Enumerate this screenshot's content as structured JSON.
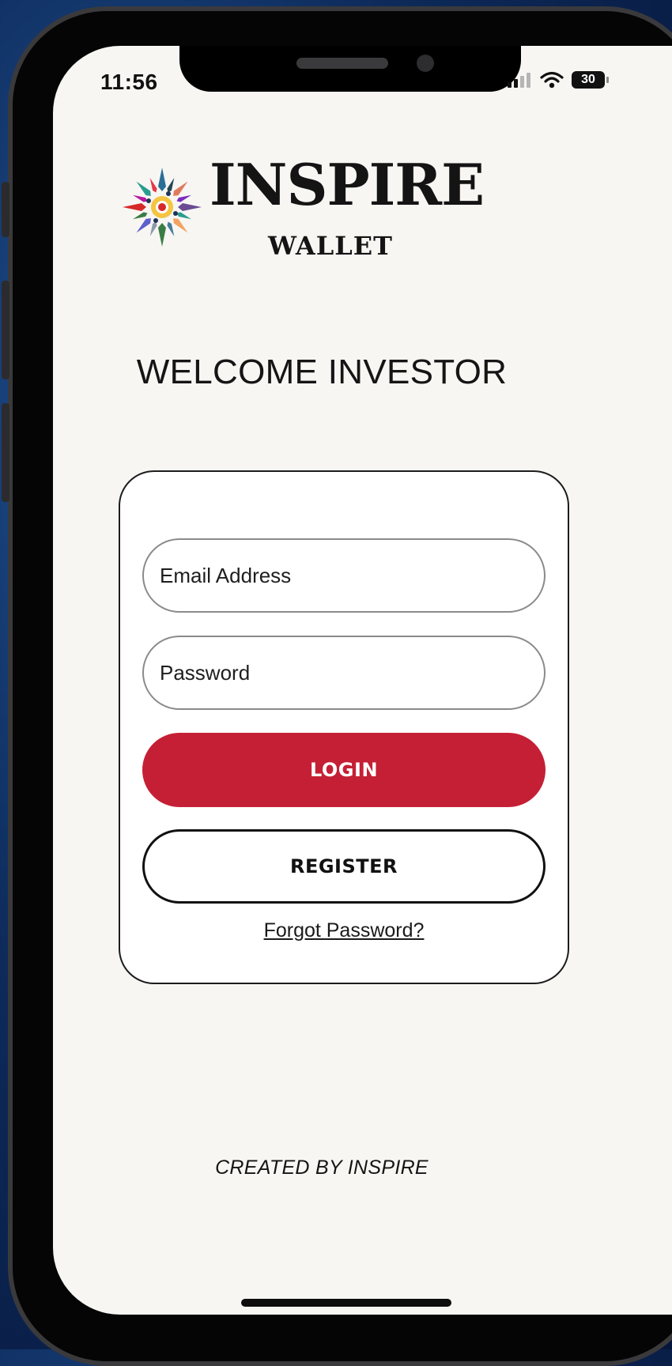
{
  "status_bar": {
    "time": "11:56",
    "battery": "30",
    "icons": [
      "signal-icon",
      "wifi-icon",
      "battery-icon"
    ]
  },
  "brand": {
    "name": "INSPIRE",
    "subtitle": "WALLET",
    "logo_icon": "sunburst-logo-icon"
  },
  "welcome": {
    "heading": "WELCOME INVESTOR"
  },
  "login_form": {
    "email_placeholder": "Email Address",
    "email_value": "",
    "password_placeholder": "Password",
    "password_value": "",
    "login_label": "LOGIN",
    "register_label": "REGISTER",
    "forgot_label": "Forgot Password?"
  },
  "footer": {
    "text": "CREATED BY INSPIRE"
  },
  "colors": {
    "login_button": "#c51f35",
    "screen_background": "#f7f6f3",
    "outer_background": "#0d2a5a"
  }
}
